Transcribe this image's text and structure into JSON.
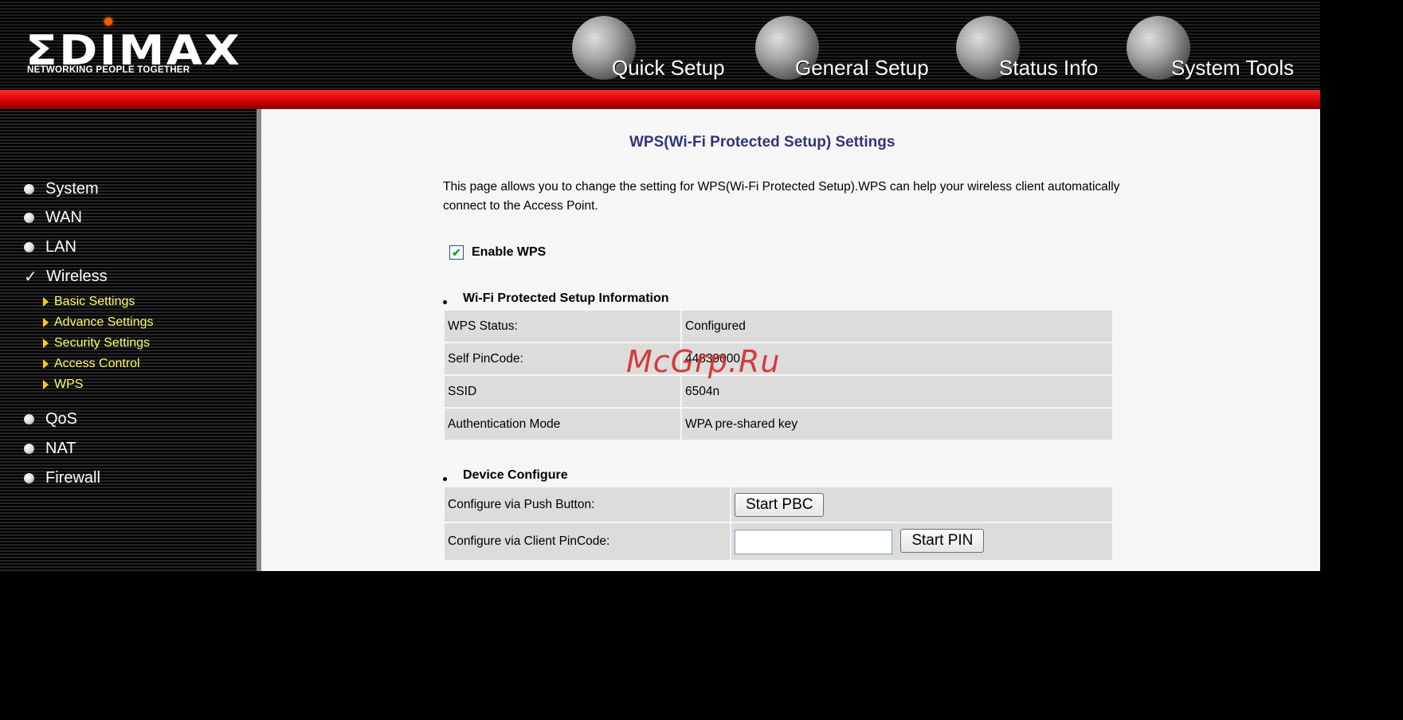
{
  "brand": {
    "logo_text": "ΣDIMAX",
    "tagline": "NETWORKING PEOPLE TOGETHER"
  },
  "topnav": [
    {
      "label": "Quick Setup"
    },
    {
      "label": "General Setup"
    },
    {
      "label": "Status Info"
    },
    {
      "label": "System Tools"
    }
  ],
  "sidebar": {
    "items": [
      {
        "label": "System"
      },
      {
        "label": "WAN"
      },
      {
        "label": "LAN"
      },
      {
        "label": "Wireless"
      },
      {
        "label": "QoS"
      },
      {
        "label": "NAT"
      },
      {
        "label": "Firewall"
      }
    ],
    "wireless_sub": [
      {
        "label": "Basic Settings"
      },
      {
        "label": "Advance Settings"
      },
      {
        "label": "Security Settings"
      },
      {
        "label": "Access Control"
      },
      {
        "label": "WPS"
      }
    ]
  },
  "page": {
    "title": "WPS(Wi-Fi Protected Setup) Settings",
    "description": "This page allows you to change the setting for WPS(Wi-Fi Protected Setup).WPS can help your wireless client automatically connect to the Access Point.",
    "enable_label": "Enable WPS",
    "enable_checked": true
  },
  "info_section": {
    "heading": "Wi-Fi Protected Setup Information",
    "rows": [
      {
        "label": "WPS Status:",
        "value": "Configured"
      },
      {
        "label": "Self PinCode:",
        "value": "44839000"
      },
      {
        "label": "SSID",
        "value": "6504n"
      },
      {
        "label": "Authentication Mode",
        "value": "WPA pre-shared key"
      }
    ]
  },
  "device_section": {
    "heading": "Device Configure",
    "pbc_label": "Configure via Push Button:",
    "pbc_button": "Start PBC",
    "pin_label": "Configure via Client PinCode:",
    "pin_value": "",
    "pin_button": "Start PIN"
  },
  "watermark": "McGrp.Ru",
  "colors": {
    "title": "#33337a",
    "submenu": "#ffff66",
    "redbar": "#d60000"
  }
}
